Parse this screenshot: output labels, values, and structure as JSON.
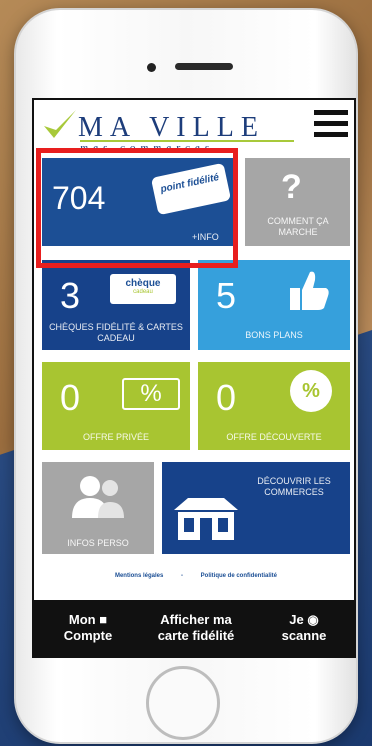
{
  "header": {
    "logo_title": "MA VILLE",
    "logo_subtitle": "mes commerces"
  },
  "tiles": {
    "points": {
      "value": "704",
      "tag": "point fidélité",
      "link": "+INFO"
    },
    "comment": {
      "icon": "?",
      "label": "COMMENT ÇA MARCHE"
    },
    "cheques": {
      "value": "3",
      "badge": "chèque",
      "badge_sub": "cadeau",
      "label": "CHÈQUES FIDÉLITÉ & CARTES CADEAU"
    },
    "bons": {
      "value": "5",
      "label": "BONS PLANS"
    },
    "offre_privee": {
      "value": "0",
      "icon_text": "%",
      "label": "OFFRE PRIVÉE"
    },
    "offre_decouverte": {
      "value": "0",
      "icon_text": "%",
      "label": "OFFRE DÉCOUVERTE"
    },
    "infos": {
      "label": "INFOS PERSO"
    },
    "decouvrir": {
      "label": "DÉCOUVRIR LES COMMERCES"
    }
  },
  "footer_links": {
    "legal": "Mentions légales",
    "sep": "-",
    "privacy": "Politique de confidentialité"
  },
  "bottom_bar": {
    "account": {
      "line1": "Mon",
      "line2": "Compte"
    },
    "card": {
      "line1": "Afficher ma",
      "line2": "carte fidélité"
    },
    "scan": {
      "line1": "Je",
      "line2": "scanne"
    }
  },
  "colors": {
    "blue": "#1c4f95",
    "sky": "#36a0dc",
    "green": "#a8c531",
    "grey": "#a6a6a6",
    "highlight": "#e81e1e"
  }
}
